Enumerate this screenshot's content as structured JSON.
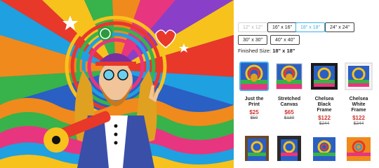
{
  "sizes": [
    {
      "label": "12\" x 12\"",
      "state": "disabled"
    },
    {
      "label": "16\" x 16\"",
      "state": "normal"
    },
    {
      "label": "18\" x 18\"",
      "state": "selected"
    },
    {
      "label": "24\" x 24\"",
      "state": "normal"
    },
    {
      "label": "30\" x 30\"",
      "state": "normal"
    },
    {
      "label": "40\" x 40\"",
      "state": "normal"
    }
  ],
  "finished_prefix": "Finished Size:",
  "finished_value": "18\" x 18\"",
  "options": [
    {
      "label_1": "Just the",
      "label_2": "Print",
      "price": "$25",
      "was": "$50"
    },
    {
      "label_1": "Stretched",
      "label_2": "Canvas",
      "price": "$65",
      "was": "$130"
    },
    {
      "label_1": "Chelsea",
      "label_2": "Black",
      "label_3": "Frame",
      "price": "$122",
      "was": "$244"
    },
    {
      "label_1": "Chelsea",
      "label_2": "White",
      "label_3": "Frame",
      "price": "$122",
      "was": "$244"
    }
  ],
  "colors": {
    "accent": "#3fb0e8",
    "sale": "#d0332b"
  }
}
